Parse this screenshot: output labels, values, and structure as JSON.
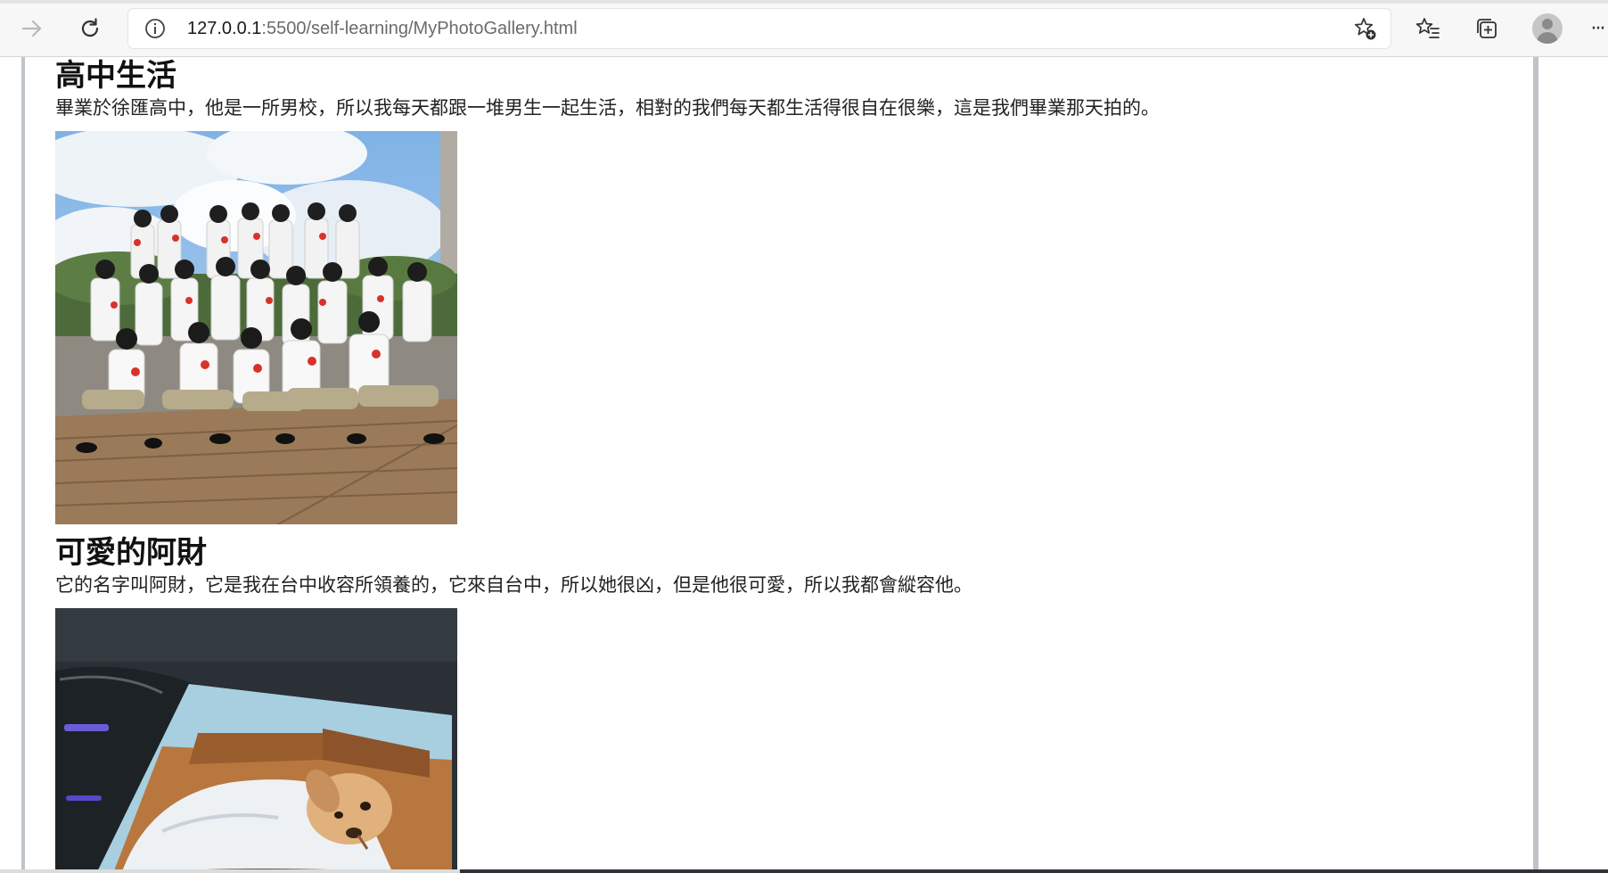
{
  "browser": {
    "url_host": "127.0.0.1",
    "url_path": ":5500/self-learning/MyPhotoGallery.html",
    "more_label": "···"
  },
  "sections": [
    {
      "title": "高中生活",
      "text": "畢業於徐匯高中，他是一所男校，所以我每天都跟一堆男生一起生活，相對的我們每天都生活得很自在很樂，這是我們畢業那天拍的。"
    },
    {
      "title": "可愛的阿財",
      "text": "它的名字叫阿財，它是我在台中收容所領養的，它來自台中，所以她很凶，但是他很可愛，所以我都會縱容他。"
    }
  ]
}
